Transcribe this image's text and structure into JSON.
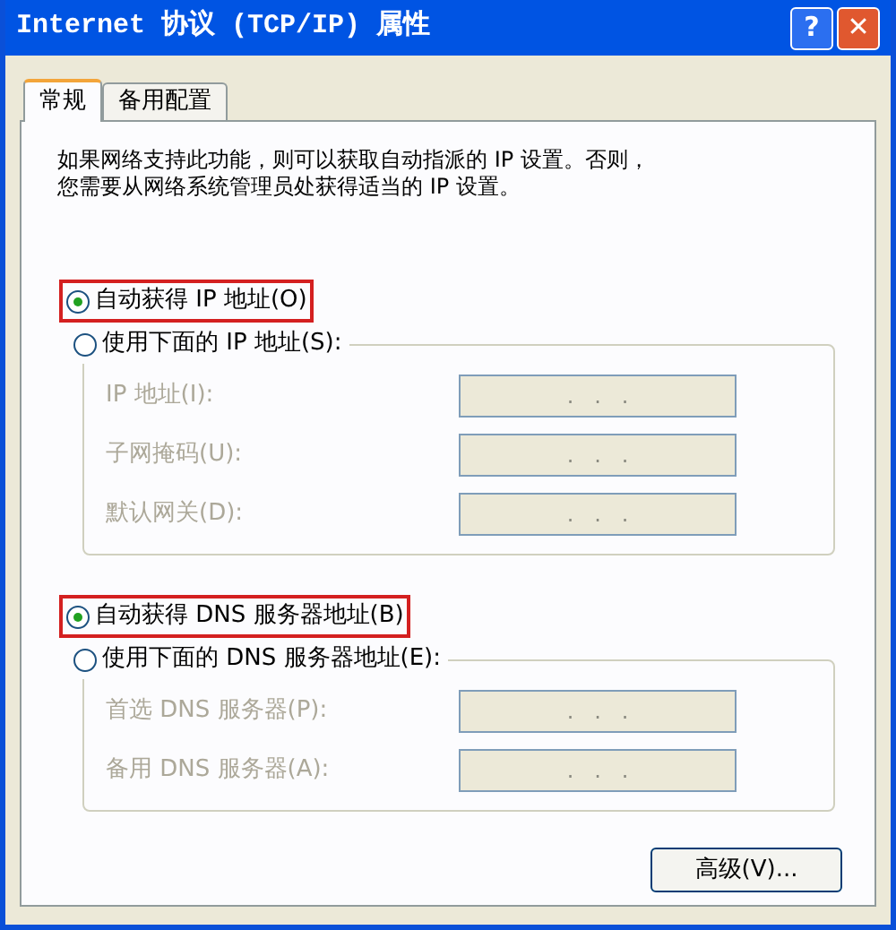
{
  "window": {
    "title": "Internet 协议 (TCP/IP) 属性",
    "buttons": [
      {
        "kind": "help",
        "label": "?"
      },
      {
        "kind": "close",
        "label": "✕"
      }
    ]
  },
  "tabs": [
    {
      "label": "常规",
      "selected": true
    },
    {
      "label": "备用配置",
      "selected": false
    }
  ],
  "description": [
    "如果网络支持此功能，则可以获取自动指派的 IP 设置。否则，",
    "您需要从网络系统管理员处获得适当的 IP 设置。"
  ],
  "sections": [
    {
      "auto_option": {
        "label": "自动获得 IP 地址(O)",
        "selected": true,
        "highlighted": true
      },
      "manual_option": {
        "label": "使用下面的 IP 地址(S):",
        "selected": false,
        "highlighted": false
      },
      "fields": [
        {
          "label": "IP 地址(I):",
          "value": ".   .   .",
          "disabled": true
        },
        {
          "label": "子网掩码(U):",
          "value": ".   .   .",
          "disabled": true
        },
        {
          "label": "默认网关(D):",
          "value": ".   .   .",
          "disabled": true
        }
      ]
    },
    {
      "auto_option": {
        "label": "自动获得 DNS 服务器地址(B)",
        "selected": true,
        "highlighted": true
      },
      "manual_option": {
        "label": "使用下面的 DNS 服务器地址(E):",
        "selected": false,
        "highlighted": false
      },
      "fields": [
        {
          "label": "首选 DNS 服务器(P):",
          "value": ".   .   .",
          "disabled": true
        },
        {
          "label": "备用 DNS 服务器(A):",
          "value": ".   .   .",
          "disabled": true
        }
      ]
    }
  ],
  "advanced_button": "高级(V)..."
}
